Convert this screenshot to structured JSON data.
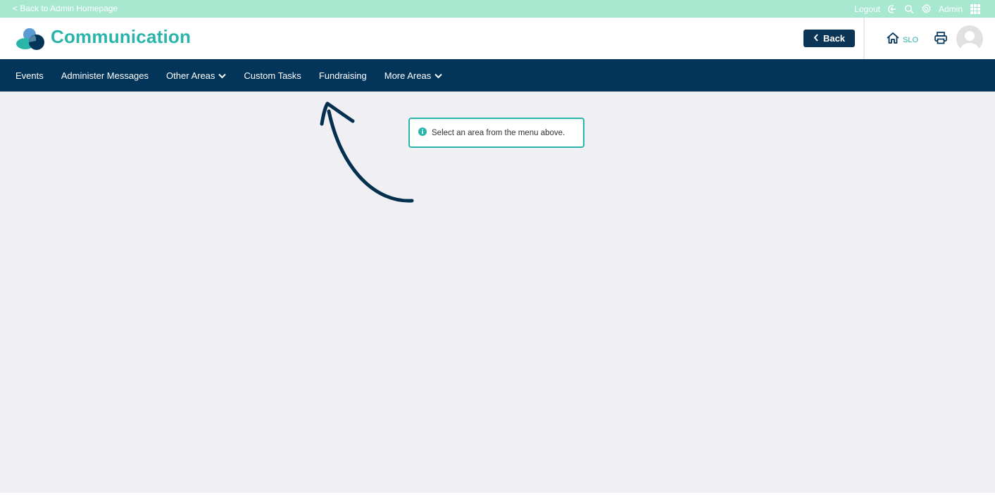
{
  "topbar": {
    "back_link": "< Back to Admin Homepage",
    "logout": "Logout",
    "admin": "Admin"
  },
  "header": {
    "title": "Communication",
    "back_button": "Back",
    "school_code": "SLO"
  },
  "nav": {
    "items": [
      {
        "label": "Events",
        "dropdown": false
      },
      {
        "label": "Administer Messages",
        "dropdown": false
      },
      {
        "label": "Other Areas",
        "dropdown": true
      },
      {
        "label": "Custom Tasks",
        "dropdown": false
      },
      {
        "label": "Fundraising",
        "dropdown": false
      },
      {
        "label": "More Areas",
        "dropdown": true
      }
    ]
  },
  "notice": {
    "text": "Select an area from the menu above."
  },
  "colors": {
    "topbar": "#a8e8d0",
    "accent": "#2bb5aa",
    "navy": "#03355a",
    "background": "#f0f0f4"
  }
}
